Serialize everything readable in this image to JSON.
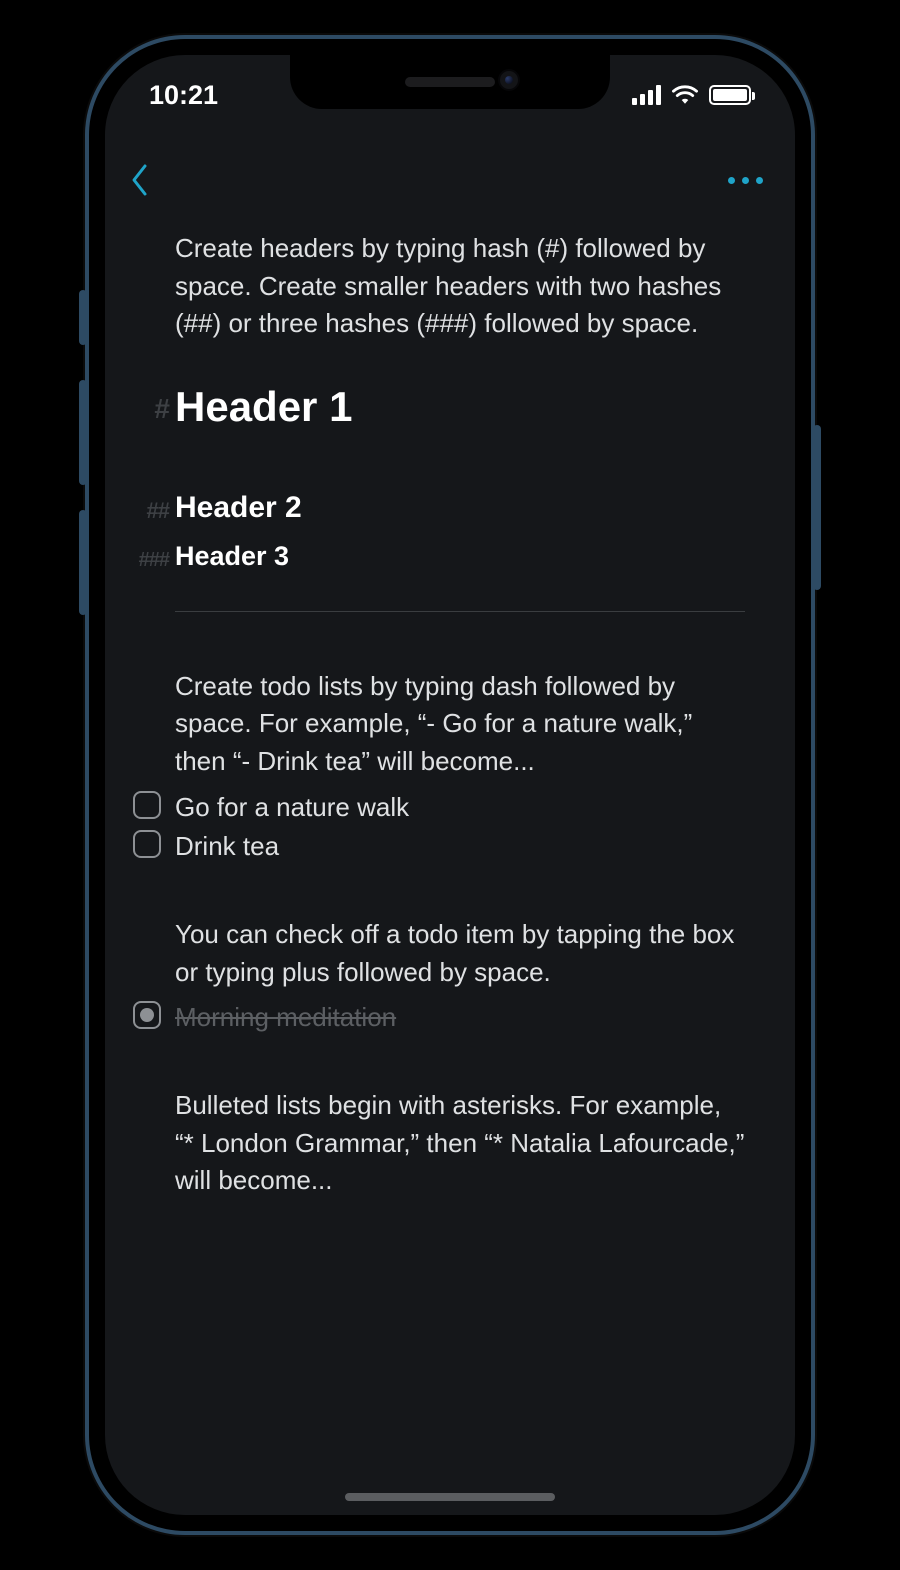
{
  "status": {
    "time": "10:21"
  },
  "content": {
    "headersIntro": "Create headers by typing hash (#) followed by space. Create smaller headers with two hashes (##) or three hashes (###) followed by space.",
    "h1mark": "#",
    "h1": "Header 1",
    "h2mark": "##",
    "h2": "Header 2",
    "h3mark": "###",
    "h3": "Header 3",
    "todoIntro": "Create todo lists by typing dash followed by space. For example, “- Go for a nature walk,” then “- Drink tea” will become...",
    "todo1": "Go for a nature walk",
    "todo2": "Drink tea",
    "checkIntro": "You can check off a todo item by tapping the box or typing plus followed by space.",
    "todoDone": "Morning meditation",
    "bulletsIntro": "Bulleted lists begin with asterisks. For example, “* London Grammar,” then “* Natalia Lafourcade,” will become..."
  }
}
